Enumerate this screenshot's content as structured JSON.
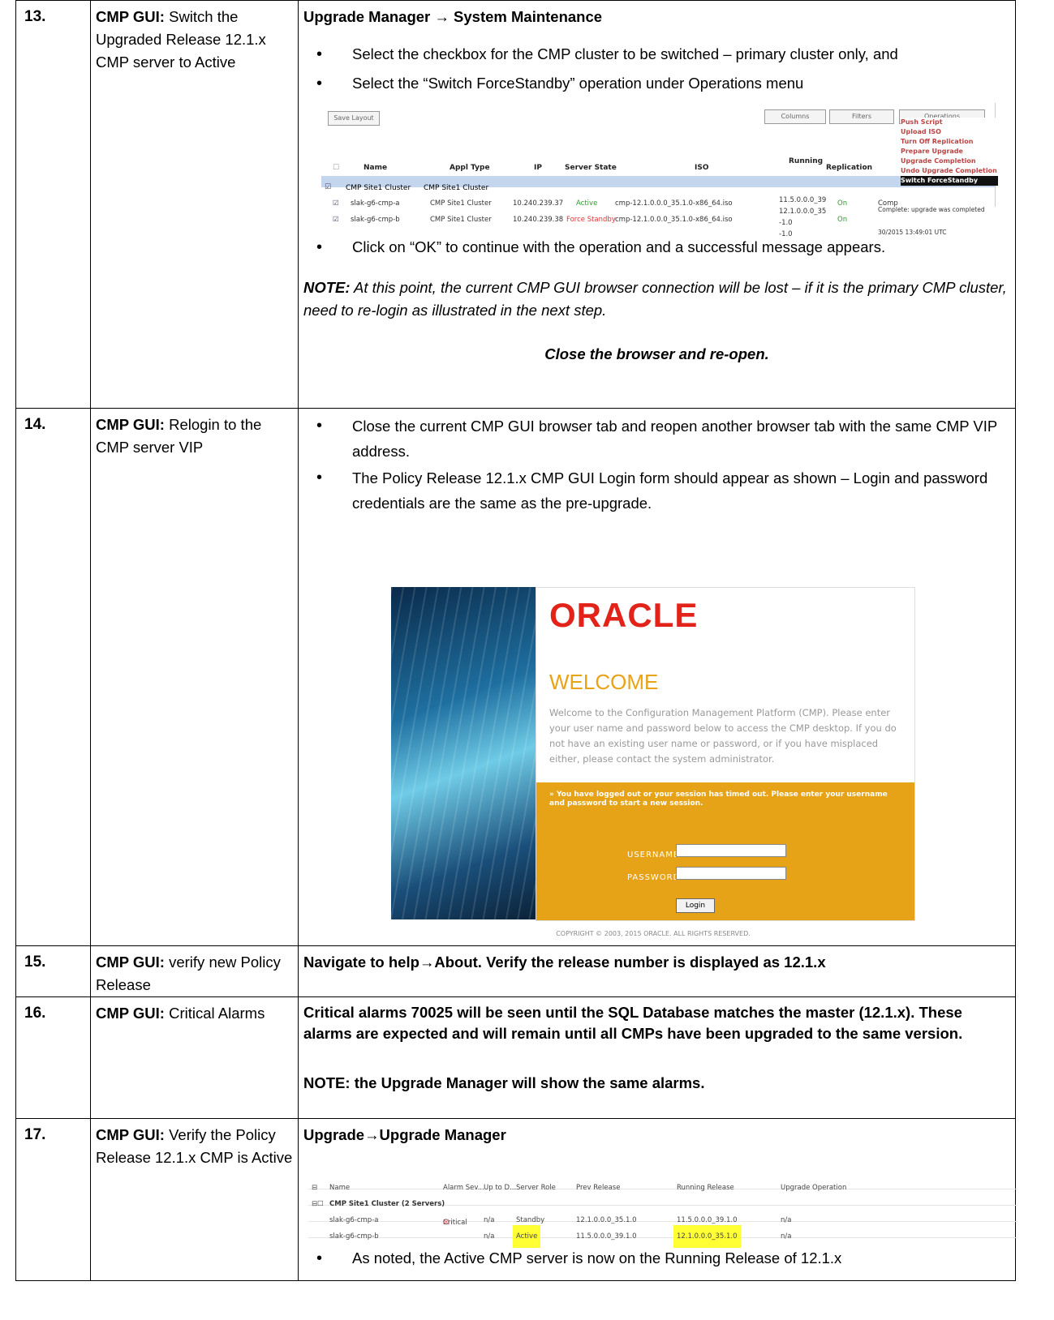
{
  "steps": [
    {
      "num": "13.",
      "title_bold": "CMP GUI:",
      "title_rest": " Switch the Upgraded Release 12.1.x CMP server to Active",
      "nav": "Upgrade Manager → System Maintenance",
      "bullets": [
        "Select the checkbox for the CMP cluster to be switched – primary cluster only, and",
        "Select the “Switch ForceStandby” operation under Operations menu"
      ],
      "bullet_after": "Click on “OK” to continue with the operation and a successful message appears.",
      "note_bold": "NOTE:",
      "note_text": "  At this point, the current CMP GUI browser connection will be lost – if it is the primary CMP cluster, need to re-login as illustrated in the next step.",
      "closing": "Close the browser and re-open."
    },
    {
      "num": "14.",
      "title_bold": "CMP GUI:",
      "title_rest": " Relogin to the CMP server VIP",
      "bullets": [
        "Close the current CMP GUI browser tab and reopen another browser tab with the same CMP VIP address.",
        "The Policy Release 12.1.x CMP GUI Login form should appear as shown – Login and password credentials are the same as the pre-upgrade."
      ]
    },
    {
      "num": "15.",
      "title_bold": "CMP GUI:",
      "title_rest": " verify new Policy Release",
      "text": "Navigate to help→About. Verify the release number is displayed as 12.1.x"
    },
    {
      "num": "16.",
      "title_bold": "CMP GUI:",
      "title_rest": " Critical Alarms",
      "text": "Critical alarms 70025 will be seen until the SQL Database matches the master (12.1.x). These alarms are expected and will remain until all CMPs have been upgraded to the same version.",
      "note": "NOTE: the Upgrade Manager will show the same alarms."
    },
    {
      "num": "17.",
      "title_bold": "CMP GUI:",
      "title_rest": " Verify the Policy Release 12.1.x CMP is Active",
      "nav": "Upgrade→Upgrade Manager",
      "bullet_after": "As noted, the Active CMP server is now on the Running Release of 12.1.x"
    }
  ],
  "ss1": {
    "save_layout": "Save Layout",
    "columns": "Columns",
    "filters": "Filters",
    "operations": "Operations",
    "headers": [
      "Name",
      "Appl Type",
      "IP",
      "Server State",
      "ISO",
      "Running Release",
      "Replication"
    ],
    "group": [
      "CMP Site1 Cluster",
      "CMP Site1 Cluster"
    ],
    "rows": [
      [
        "slak-g6-cmp-a",
        "CMP Site1 Cluster",
        "10.240.239.37",
        "Active",
        "cmp-12.1.0.0.0_35.1.0-x86_64.iso",
        "11.5.0.0.0_39 -1.0",
        "On",
        "Comp"
      ],
      [
        "slak-g6-cmp-b",
        "CMP Site1 Cluster",
        "10.240.239.38",
        "Force Standby",
        "cmp-12.1.0.0.0_35.1.0-x86_64.iso",
        "12.1.0.0.0_35 -1.0",
        "On",
        "Complete: upgrade was completed 30/2015 13:49:01 UTC"
      ]
    ],
    "menu": [
      "Push Script",
      "Upload ISO",
      "Turn Off Replication",
      "Prepare Upgrade",
      "Upgrade Completion",
      "Undo Upgrade Completion",
      "Switch ForceStandby"
    ]
  },
  "login": {
    "logo": "ORACLE",
    "welcome": "WELCOME",
    "para": "Welcome to the Configuration Management Platform (CMP). Please enter your user name and password below to access the CMP desktop. If you do not have an existing user name or password, or if you have misplaced either, please contact the system administrator.",
    "msg": "» You have logged out or your session has timed out. Please enter your username and password to start a new session.",
    "username": "USERNAME",
    "password": "PASSWORD",
    "login_btn": "Login",
    "copyright": "COPYRIGHT © 2003, 2015 ORACLE. ALL RIGHTS RESERVED."
  },
  "ss2": {
    "headers": [
      "Name",
      "Alarm Sev...",
      "Up to D...",
      "Server Role",
      "Prev Release",
      "Running Release",
      "Upgrade Operation"
    ],
    "group": "CMP Site1 Cluster (2 Servers)",
    "rows": [
      [
        "slak-g6-cmp-a",
        "Critical",
        "n/a",
        "Standby",
        "12.1.0.0.0_35.1.0",
        "11.5.0.0.0_39.1.0",
        "n/a"
      ],
      [
        "slak-g6-cmp-b",
        "",
        "n/a",
        "Active",
        "11.5.0.0.0_39.1.0",
        "12.1.0.0.0_35.1.0",
        "n/a"
      ]
    ]
  }
}
